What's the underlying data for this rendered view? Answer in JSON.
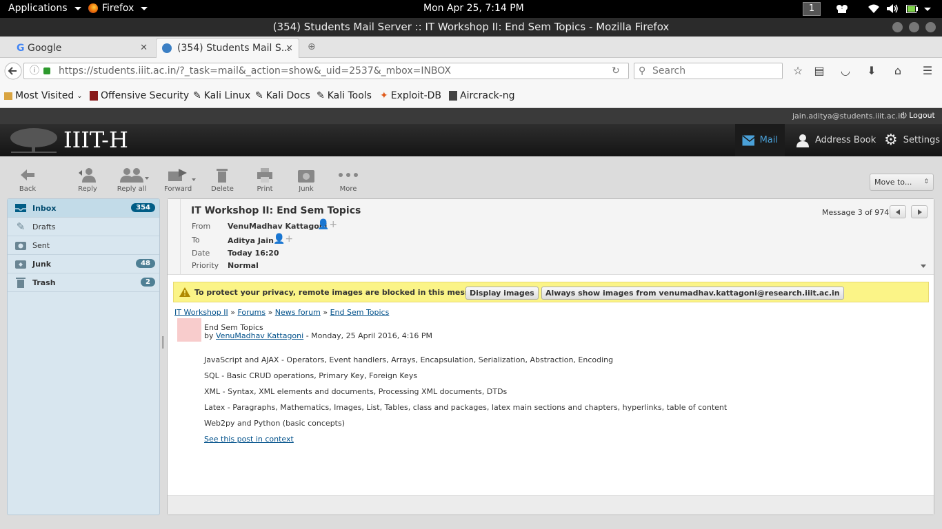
{
  "system": {
    "applications_label": "Applications",
    "firefox_label": "Firefox",
    "clock": "Mon Apr 25,  7:14 PM",
    "workspace": "1"
  },
  "window": {
    "title": "(354) Students Mail Server :: IT Workshop II: End Sem Topics - Mozilla Firefox"
  },
  "tabs": [
    {
      "label": "Google",
      "icon": "google-icon"
    },
    {
      "label": "(354) Students Mail S...",
      "icon": "roundcube-icon"
    }
  ],
  "nav": {
    "url": "https://students.iiit.ac.in/?_task=mail&_action=show&_uid=2537&_mbox=INBOX",
    "search_placeholder": "Search"
  },
  "bookmarks": [
    {
      "label": "Most Visited",
      "icon": "folder-icon"
    },
    {
      "label": "Offensive Security",
      "icon": "offsec-icon"
    },
    {
      "label": "Kali Linux",
      "icon": "kali-icon"
    },
    {
      "label": "Kali Docs",
      "icon": "kali-icon"
    },
    {
      "label": "Kali Tools",
      "icon": "kali-icon"
    },
    {
      "label": "Exploit-DB",
      "icon": "exploitdb-icon"
    },
    {
      "label": "Aircrack-ng",
      "icon": "aircrack-icon"
    }
  ],
  "webmail": {
    "user": "jain.aditya@students.iiit.ac.in",
    "logout": "Logout",
    "logo_text": "IIIT-H",
    "nav": {
      "mail": "Mail",
      "address_book": "Address Book",
      "settings": "Settings"
    }
  },
  "toolbar": {
    "back": "Back",
    "reply": "Reply",
    "reply_all": "Reply all",
    "forward": "Forward",
    "delete": "Delete",
    "print": "Print",
    "junk": "Junk",
    "more": "More",
    "move_to": "Move to..."
  },
  "folders": [
    {
      "label": "Inbox",
      "count": "354",
      "icon": "inbox-icon"
    },
    {
      "label": "Drafts",
      "count": "",
      "icon": "pencil-icon"
    },
    {
      "label": "Sent",
      "count": "",
      "icon": "sent-icon"
    },
    {
      "label": "Junk",
      "count": "48",
      "icon": "junk-icon"
    },
    {
      "label": "Trash",
      "count": "2",
      "icon": "trash-icon"
    }
  ],
  "message": {
    "subject": "IT Workshop II: End Sem Topics",
    "counter": "Message 3 of 974",
    "labels": {
      "from": "From",
      "to": "To",
      "date": "Date",
      "priority": "Priority"
    },
    "from": "VenuMadhav Kattagoni",
    "to": "Aditya Jain",
    "date": "Today 16:20",
    "priority": "Normal",
    "warning": "To protect your privacy, remote images are blocked in this message.",
    "display_images": "Display images",
    "always_show": "Always show images from venumadhav.kattagoni@research.iiit.ac.in",
    "breadcrumb": [
      "IT Workshop II",
      "Forums",
      "News forum",
      "End Sem Topics"
    ],
    "breadcrumb_sep": "»",
    "post_title": "End Sem Topics",
    "post_by": "by",
    "post_author": "VenuMadhav Kattagoni",
    "post_date": "- Monday, 25 April 2016, 4:16 PM",
    "lines": [
      "JavaScript and AJAX - Operators, Event handlers, Arrays, Encapsulation, Serialization, Abstraction, Encoding",
      "SQL - Basic CRUD operations, Primary Key, Foreign Keys",
      "XML - Syntax, XML elements and documents, Processing XML documents, DTDs",
      "Latex - Paragraphs, Mathematics, Images, List, Tables, class and packages, latex main sections and chapters, hyperlinks, table of content",
      "Web2py and Python (basic concepts)"
    ],
    "context_link": "See this post in context"
  },
  "colors": {
    "accent": "#4aa0d8",
    "warning_bg": "#fbf487",
    "folder_bg": "#d8e6ef"
  }
}
